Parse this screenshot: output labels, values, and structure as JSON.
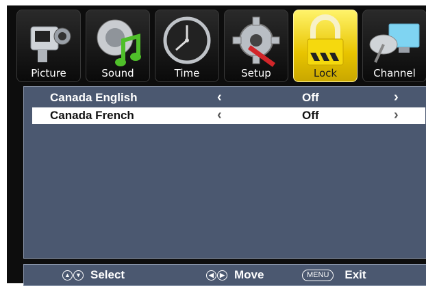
{
  "tabs": [
    {
      "label": "Picture",
      "icon": "camcorder-icon",
      "active": false
    },
    {
      "label": "Sound",
      "icon": "speaker-music-note-icon",
      "active": false
    },
    {
      "label": "Time",
      "icon": "clock-icon",
      "active": false
    },
    {
      "label": "Setup",
      "icon": "gear-wrench-icon",
      "active": false
    },
    {
      "label": "Lock",
      "icon": "padlock-icon",
      "active": true
    },
    {
      "label": "Channel",
      "icon": "satellite-dish-icon",
      "active": false
    }
  ],
  "rows": [
    {
      "name": "Canada English",
      "value": "Off",
      "left_arrow": "‹",
      "right_arrow": "›"
    },
    {
      "name": "Canada French",
      "value": "Off",
      "left_arrow": "‹",
      "right_arrow": "›"
    }
  ],
  "footer": {
    "select_label": "Select",
    "move_label": "Move",
    "menu_key": "MENU",
    "exit_label": "Exit"
  },
  "colors": {
    "panel": "#4b5870",
    "active_tab": "#f2d81a",
    "selected_row": "#ffffff",
    "background": "#0d0d0d"
  }
}
